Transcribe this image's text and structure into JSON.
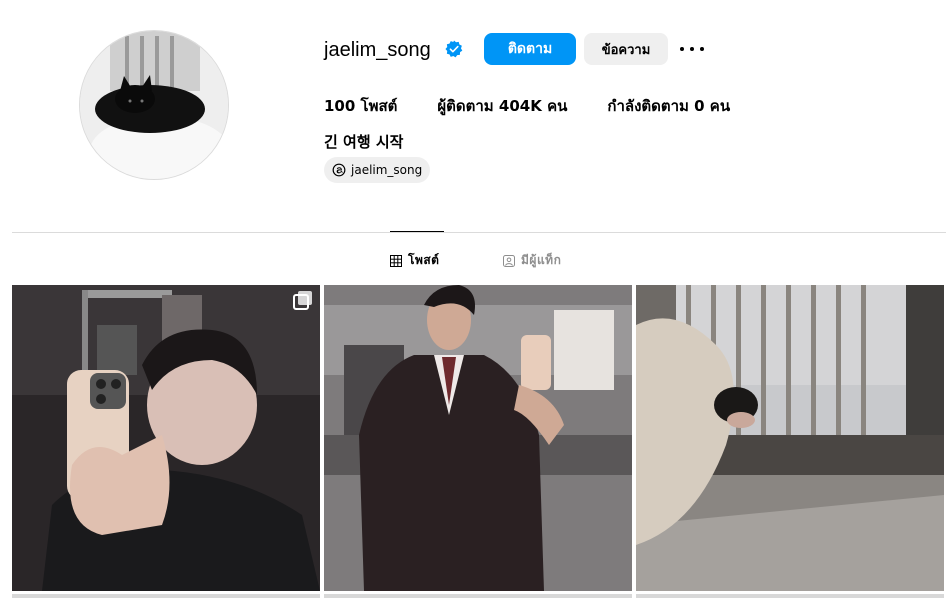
{
  "profile": {
    "username": "jaelim_song",
    "follow_label": "ติดตาม",
    "message_label": "ข้อความ",
    "stats": {
      "posts": "100 โพสต์",
      "followers": "ผู้ติดตาม 404K คน",
      "following": "กำลังติดตาม 0 คน"
    },
    "bio_name": "긴 여행 시작",
    "threads_handle": "jaelim_song"
  },
  "tabs": {
    "posts": "โพสต์",
    "tagged": "มีผู้แท็ก"
  },
  "colors": {
    "accent": "#0095f6",
    "secondary_button": "#efefef",
    "divider": "#dbdbdb",
    "muted_text": "#8e8e8e"
  },
  "icons": {
    "verified": "verified-badge-icon",
    "more": "more-options-icon",
    "threads": "threads-icon",
    "grid": "grid-icon",
    "tagged": "tagged-icon",
    "carousel": "multiple-images-icon"
  }
}
